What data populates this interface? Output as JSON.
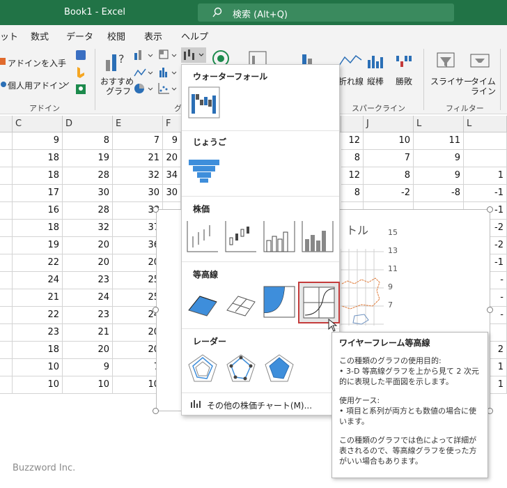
{
  "titlebar": {
    "title": "Book1  -  Excel",
    "search": "検索 (Alt+Q)"
  },
  "tabs": [
    "ット",
    "数式",
    "データ",
    "校閲",
    "表示",
    "ヘルプ"
  ],
  "ribbon": {
    "addin_get": "アドインを入手",
    "addin_personal": "個人用アドイン",
    "addin_group": "アドイン",
    "recommend1": "おすすめ",
    "recommend2": "グラフ",
    "graph_group_partial": "グ",
    "sparkline_line": "折れ線",
    "sparkline_col": "縦棒",
    "sparkline_win": "勝敗",
    "sparkline_group": "スパークライン",
    "slicer": "スライサー",
    "timeline1": "タイム",
    "timeline2": "ライン",
    "filter_group": "フィルター"
  },
  "columns": [
    "C",
    "D",
    "E",
    "F",
    "J",
    "L",
    "L"
  ],
  "rows": [
    {
      "c": "9",
      "d": "8",
      "e": "7",
      "f": "9",
      "j0": "12",
      "j": "10",
      "l": "11",
      "l2": ""
    },
    {
      "c": "18",
      "d": "19",
      "e": "21",
      "f": "20",
      "j0": "8",
      "j": "7",
      "l": "9",
      "l2": ""
    },
    {
      "c": "18",
      "d": "28",
      "e": "32",
      "f": "34",
      "j0": "12",
      "j": "8",
      "l": "9",
      "l2": "1"
    },
    {
      "c": "17",
      "d": "30",
      "e": "30",
      "f": "30",
      "j0": "8",
      "j": "-2",
      "l": "-8",
      "l2": "-1"
    },
    {
      "c": "16",
      "d": "28",
      "e": "38",
      "f": "",
      "j0": "",
      "j": "",
      "l": "",
      "l2": "-1"
    },
    {
      "c": "18",
      "d": "32",
      "e": "37",
      "f": "",
      "j0": "",
      "j": "",
      "l": "",
      "l2": "-2"
    },
    {
      "c": "19",
      "d": "20",
      "e": "36",
      "f": "",
      "j0": "",
      "j": "",
      "l": "",
      "l2": "-2"
    },
    {
      "c": "22",
      "d": "20",
      "e": "20",
      "f": "",
      "j0": "",
      "j": "",
      "l": "",
      "l2": "-1"
    },
    {
      "c": "24",
      "d": "23",
      "e": "25",
      "f": "",
      "j0": "",
      "j": "",
      "l": "",
      "l2": "-"
    },
    {
      "c": "21",
      "d": "24",
      "e": "25",
      "f": "",
      "j0": "",
      "j": "",
      "l": "",
      "l2": "-"
    },
    {
      "c": "22",
      "d": "23",
      "e": "24",
      "f": "",
      "j0": "",
      "j": "",
      "l": "",
      "l2": "-"
    },
    {
      "c": "23",
      "d": "21",
      "e": "20",
      "f": "",
      "j0": "",
      "j": "",
      "l": "",
      "l2": ""
    },
    {
      "c": "18",
      "d": "20",
      "e": "20",
      "f": "",
      "j0": "",
      "j": "",
      "l": "",
      "l2": "2"
    },
    {
      "c": "10",
      "d": "9",
      "e": "7",
      "f": "",
      "j0": "",
      "j": "",
      "l": "",
      "l2": "1"
    },
    {
      "c": "10",
      "d": "10",
      "e": "10",
      "f": "",
      "j0": "",
      "j": "",
      "l": "",
      "l2": "1"
    }
  ],
  "chart": {
    "title_partial": "トル",
    "yticks": [
      "15",
      "13",
      "11",
      "9",
      "7"
    ]
  },
  "dropdown": {
    "waterfall": "ウォーターフォール",
    "funnel": "じょうご",
    "stock": "株価",
    "surface": "等高線",
    "radar": "レーダー",
    "more": "その他の株価チャート(M)..."
  },
  "tooltip": {
    "title": "ワイヤーフレーム等高線",
    "purpose": "この種類のグラフの使用目的:\n• 3-D 等高線グラフを上から見て 2 次元的に表現した平面図を示します。",
    "usecase": "使用ケース:\n• 項目と系列が両方とも数値の場合に使います。",
    "note": "この種類のグラフでは色によって詳細が表されるので、等高線グラフを使った方がいい場合もあります。"
  },
  "watermark": "Buzzword Inc.",
  "colors": {
    "excel_green": "#217346",
    "surface_blue": "#3e8edb",
    "selected_border": "#c43b3b"
  }
}
